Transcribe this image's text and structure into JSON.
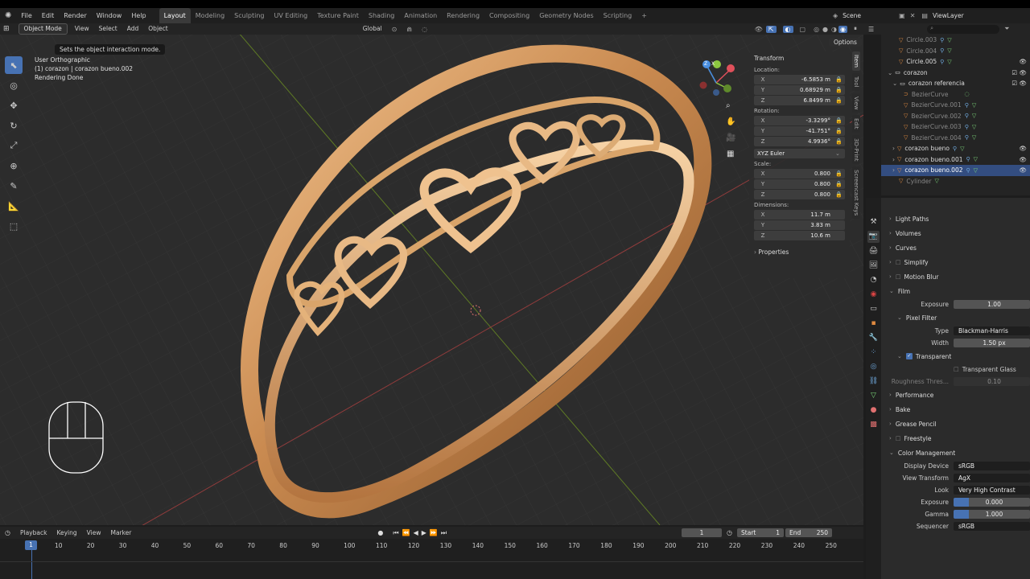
{
  "topbar": {
    "menus": [
      "File",
      "Edit",
      "Render",
      "Window",
      "Help"
    ],
    "workspaces": [
      "Layout",
      "Modeling",
      "Sculpting",
      "UV Editing",
      "Texture Paint",
      "Shading",
      "Animation",
      "Rendering",
      "Compositing",
      "Geometry Nodes",
      "Scripting"
    ],
    "active_workspace": "Layout",
    "add_tab": "+",
    "scene": "Scene",
    "view_layer": "ViewLayer"
  },
  "viewport_header": {
    "mode": "Object Mode",
    "menus": [
      "View",
      "Select",
      "Add",
      "Object"
    ],
    "transform_orientation": "Global",
    "options": "Options"
  },
  "tooltip": "Sets the object interaction mode.",
  "viewport": {
    "view_name": "User Orthographic",
    "object_info": "(1) corazon | corazon bueno.002",
    "status": "Rendering Done",
    "gizmo_axes": {
      "x": "X",
      "y": "Y",
      "z": "Z"
    }
  },
  "npanel": {
    "title": "Transform",
    "location_label": "Location:",
    "location": [
      {
        "axis": "X",
        "value": "-6.5853 m"
      },
      {
        "axis": "Y",
        "value": "0.68929 m"
      },
      {
        "axis": "Z",
        "value": "6.8499 m"
      }
    ],
    "rotation_label": "Rotation:",
    "rotation": [
      {
        "axis": "X",
        "value": "-3.3299°"
      },
      {
        "axis": "Y",
        "value": "-41.751°"
      },
      {
        "axis": "Z",
        "value": "4.9936°"
      }
    ],
    "rotation_mode": "XYZ Euler",
    "scale_label": "Scale:",
    "scale": [
      {
        "axis": "X",
        "value": "0.800"
      },
      {
        "axis": "Y",
        "value": "0.800"
      },
      {
        "axis": "Z",
        "value": "0.800"
      }
    ],
    "dimensions_label": "Dimensions:",
    "dimensions": [
      {
        "axis": "X",
        "value": "11.7 m"
      },
      {
        "axis": "Y",
        "value": "3.83 m"
      },
      {
        "axis": "Z",
        "value": "10.6 m"
      }
    ],
    "properties": "Properties",
    "tabs": [
      "Item",
      "Tool",
      "View",
      "Edit",
      "3D-Print",
      "Screencast Keys"
    ]
  },
  "outliner": {
    "rows": [
      {
        "name": "Circle.003",
        "dim": true
      },
      {
        "name": "Circle.004",
        "dim": true
      },
      {
        "name": "Circle.005",
        "dim": false
      },
      {
        "name": "corazon",
        "dim": false
      },
      {
        "name": "corazon referencia",
        "dim": false
      },
      {
        "name": "BezierCurve",
        "dim": true
      },
      {
        "name": "BezierCurve.001",
        "dim": true
      },
      {
        "name": "BezierCurve.002",
        "dim": true
      },
      {
        "name": "BezierCurve.003",
        "dim": true
      },
      {
        "name": "BezierCurve.004",
        "dim": true
      },
      {
        "name": "corazon bueno",
        "dim": false
      },
      {
        "name": "corazon bueno.001",
        "dim": false
      },
      {
        "name": "corazon bueno.002",
        "dim": false
      },
      {
        "name": "Cylinder",
        "dim": true
      }
    ]
  },
  "properties": {
    "sections": {
      "light_paths": "Light Paths",
      "volumes": "Volumes",
      "curves": "Curves",
      "simplify": "Simplify",
      "motion_blur": "Motion Blur",
      "film": "Film",
      "pixel_filter": "Pixel Filter",
      "performance": "Performance",
      "bake": "Bake",
      "grease_pencil": "Grease Pencil",
      "freestyle": "Freestyle",
      "color_management": "Color Management"
    },
    "exposure_label": "Exposure",
    "exposure_value": "1.00",
    "type_label": "Type",
    "type_value": "Blackman-Harris",
    "width_label": "Width",
    "width_value": "1.50 px",
    "transparent": "Transparent",
    "transparent_glass": "Transparent Glass",
    "roughness_label": "Roughness Thres...",
    "roughness_value": "0.10",
    "display_device_label": "Display Device",
    "display_device": "sRGB",
    "view_transform_label": "View Transform",
    "view_transform": "AgX",
    "look_label": "Look",
    "look": "Very High Contrast",
    "cm_exposure_label": "Exposure",
    "cm_exposure": "0.000",
    "gamma_label": "Gamma",
    "gamma": "1.000",
    "sequencer_label": "Sequencer",
    "sequencer": "sRGB"
  },
  "timeline": {
    "menus": [
      "Playback",
      "Keying",
      "View",
      "Marker"
    ],
    "current_frame": "1",
    "start_label": "Start",
    "start": "1",
    "end_label": "End",
    "end": "250",
    "ticks": [
      "10",
      "20",
      "30",
      "40",
      "50",
      "60",
      "70",
      "80",
      "90",
      "100",
      "110",
      "120",
      "130",
      "140",
      "150",
      "160",
      "170",
      "180",
      "190",
      "200",
      "210",
      "220",
      "230",
      "240",
      "250"
    ],
    "frame_indicator": "1"
  },
  "colors": {
    "accent": "#4772b3",
    "gold": "#d9a46a",
    "x_axis": "#e0505b",
    "y_axis": "#8cc63f",
    "z_axis": "#4a90e2"
  }
}
